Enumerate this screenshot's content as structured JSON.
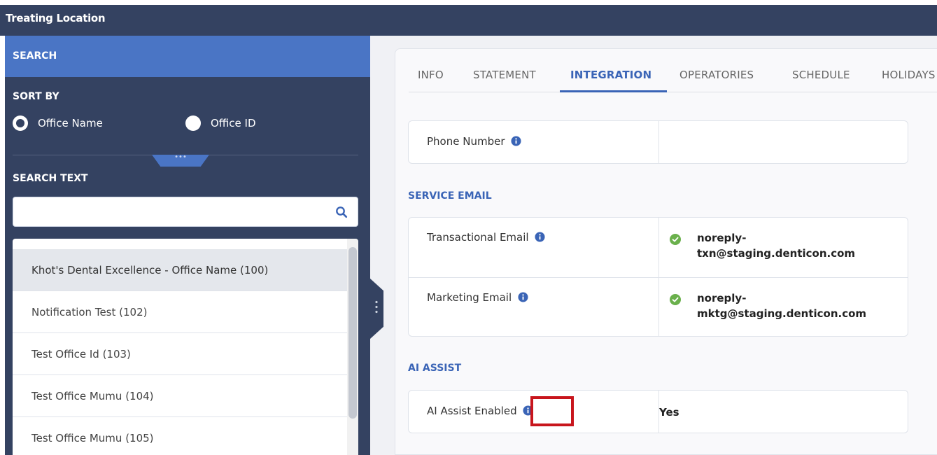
{
  "window": {
    "title": "Treating Location"
  },
  "sidebar": {
    "search_header": "SEARCH",
    "sort_by_label": "SORT BY",
    "sort_options": [
      {
        "label": "Office Name",
        "selected": true
      },
      {
        "label": "Office ID",
        "selected": false
      }
    ],
    "collapse_glyph": "•••",
    "search_text_label": "SEARCH TEXT",
    "search_input": {
      "value": "",
      "placeholder": ""
    },
    "offices": [
      {
        "label": "Khot's Dental Excellence - Office Name (100)",
        "selected": true
      },
      {
        "label": "Notification Test (102)",
        "selected": false
      },
      {
        "label": "Test Office Id (103)",
        "selected": false
      },
      {
        "label": "Test Office Mumu (104)",
        "selected": false
      },
      {
        "label": "Test Office Mumu (105)",
        "selected": false
      }
    ]
  },
  "tabs": [
    {
      "label": "INFO",
      "active": false
    },
    {
      "label": "STATEMENT",
      "active": false
    },
    {
      "label": "INTEGRATION",
      "active": true
    },
    {
      "label": "OPERATORIES",
      "active": false
    },
    {
      "label": "SCHEDULE",
      "active": false
    },
    {
      "label": "HOLIDAYS",
      "active": false
    }
  ],
  "integration": {
    "phone": {
      "label": "Phone Number",
      "value": ""
    },
    "service_email": {
      "title": "SERVICE EMAIL",
      "transactional": {
        "label": "Transactional Email",
        "value_line1": "noreply-",
        "value_line2": "txn@staging.denticon.com"
      },
      "marketing": {
        "label": "Marketing Email",
        "value_line1": "noreply-",
        "value_line2": "mktg@staging.denticon.com"
      }
    },
    "ai_assist": {
      "title": "AI ASSIST",
      "enabled": {
        "label": "AI Assist Enabled",
        "value": "Yes"
      }
    }
  },
  "colors": {
    "sidebar_bg": "#344261",
    "accent_blue": "#4a75c5",
    "tab_active": "#3a64b6",
    "check_green": "#6ab04c",
    "highlight_red": "#c8161d"
  }
}
